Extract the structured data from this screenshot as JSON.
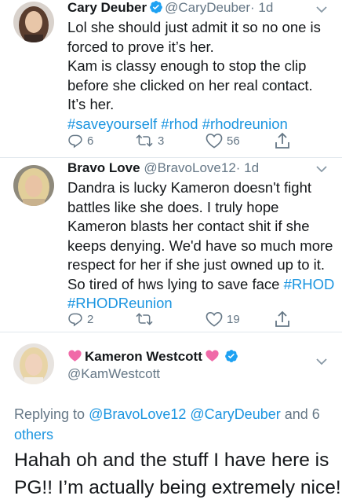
{
  "tweets": [
    {
      "name": "Cary Deuber",
      "handle": "@CaryDeuber",
      "time": "· 1d",
      "lines": [
        "Lol she should just admit it so no one is",
        "forced to prove it’s her.",
        "Kam is classy enough to stop the clip",
        "before she clicked on her real contact.",
        "It’s her."
      ],
      "hashtags": "#saveyourself #rhod #rhodreunion",
      "replies": "6",
      "retweets": "3",
      "likes": "56"
    },
    {
      "name": "Bravo Love",
      "handle": "@BravoLove12",
      "time": "· 1d",
      "lines": [
        "Dandra is lucky Kameron doesn't fight",
        "battles like she does. I truly hope",
        "Kameron blasts her contact shit if she",
        "keeps denying. We'd have so much more",
        "respect for her if she just owned up to it."
      ],
      "line6_prefix": "So tired of hws lying to save face ",
      "line6_tag": "#RHOD",
      "line7_tag": "#RHODReunion",
      "replies": "2",
      "retweets": "",
      "likes": "19"
    }
  ],
  "focus": {
    "name": "Kameron Westcott",
    "handle": "@KamWestcott",
    "replying_prefix": "Replying to ",
    "replying_mentions": "@BravoLove12 @CaryDeuber",
    "replying_and": " and 6",
    "replying_others": "others",
    "lines": [
      "Hahah oh and the stuff I have here is",
      "PG!! I’m actually being extremely nice!!"
    ]
  },
  "colors": {
    "link": "#1b95e0",
    "muted": "#657786",
    "verified": "#1da1f2",
    "heart": "#e0245e"
  },
  "icons": [
    "verified-icon",
    "reply-icon",
    "retweet-icon",
    "like-icon",
    "share-icon",
    "chevron-down-icon",
    "pink-heart-icon"
  ]
}
